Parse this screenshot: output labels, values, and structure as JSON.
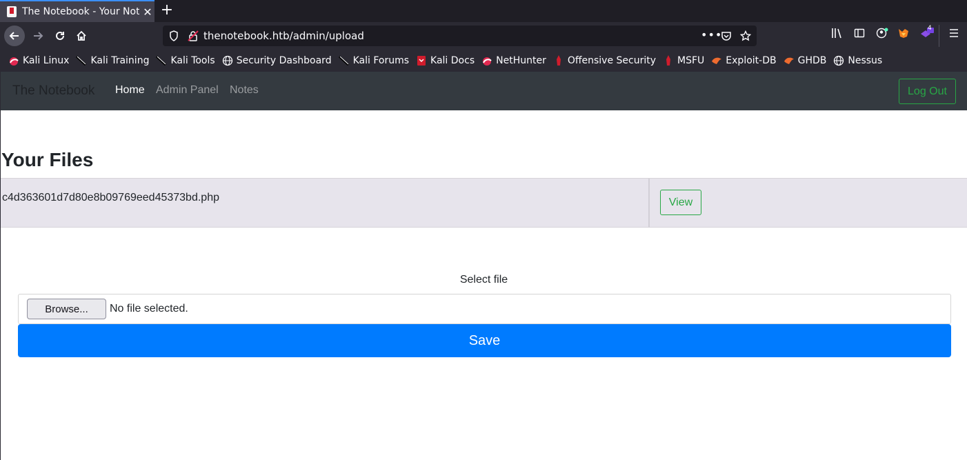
{
  "browser": {
    "tab_title": "The Notebook - Your Notes",
    "url": "thenotebook.htb/admin/upload",
    "extension_badge": "4"
  },
  "bookmarks": [
    {
      "label": "Kali Linux",
      "icon": "kali-dragon-icon"
    },
    {
      "label": "Kali Training",
      "icon": "kali-dagger-icon"
    },
    {
      "label": "Kali Tools",
      "icon": "kali-dagger-icon"
    },
    {
      "label": "Security Dashboard",
      "icon": "globe-icon"
    },
    {
      "label": "Kali Forums",
      "icon": "kali-dagger-icon"
    },
    {
      "label": "Kali Docs",
      "icon": "kali-docs-icon"
    },
    {
      "label": "NetHunter",
      "icon": "kali-dragon-icon"
    },
    {
      "label": "Offensive Security",
      "icon": "offsec-icon"
    },
    {
      "label": "MSFU",
      "icon": "offsec-icon"
    },
    {
      "label": "Exploit-DB",
      "icon": "exploitdb-icon"
    },
    {
      "label": "GHDB",
      "icon": "exploitdb-icon"
    },
    {
      "label": "Nessus",
      "icon": "globe-icon"
    }
  ],
  "site": {
    "brand": "The Notebook",
    "nav": {
      "home": "Home",
      "admin": "Admin Panel",
      "notes": "Notes"
    },
    "logout": "Log Out"
  },
  "files": {
    "heading": "Your Files",
    "rows": [
      {
        "name": "c4d363601d7d80e8b09769eed45373bd.php",
        "action": "View"
      }
    ]
  },
  "upload": {
    "label": "Select file",
    "browse": "Browse...",
    "status": "No file selected.",
    "save": "Save"
  },
  "colors": {
    "primary": "#007bff",
    "success": "#28a745",
    "navbar": "#343a40",
    "row_bg": "#e7e4ec"
  }
}
